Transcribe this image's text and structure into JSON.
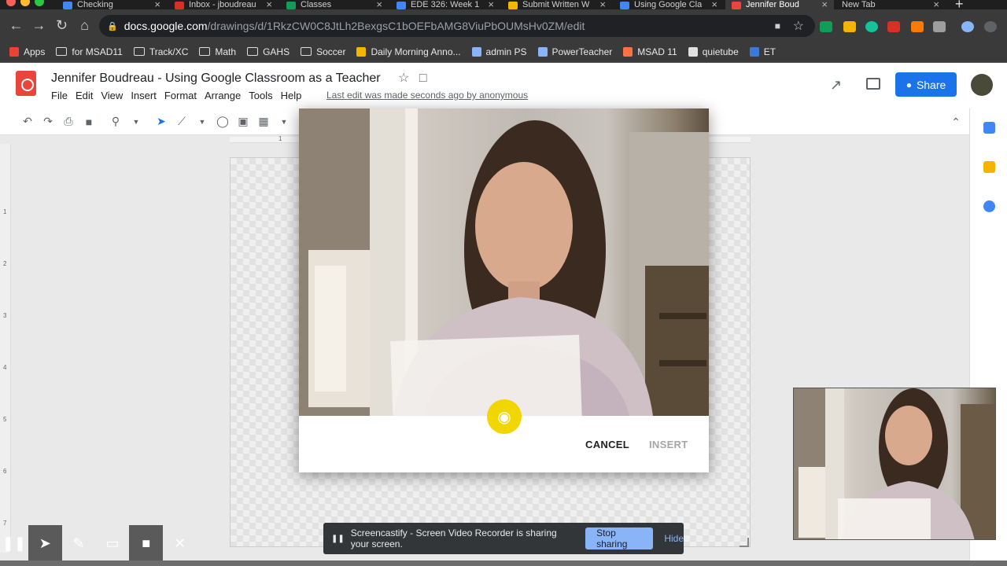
{
  "tabs": [
    {
      "label": "Checking",
      "color": "#4285f4",
      "active": false
    },
    {
      "label": "Inbox - jboudreau",
      "color": "#d93025",
      "active": false
    },
    {
      "label": "Classes",
      "color": "#0f9d58",
      "active": false
    },
    {
      "label": "EDE 326: Week 1",
      "color": "#4285f4",
      "active": false
    },
    {
      "label": "Submit Written W",
      "color": "#f4b400",
      "active": false
    },
    {
      "label": "Using Google Cla",
      "color": "#4285f4",
      "active": false
    },
    {
      "label": "Jennifer Boud",
      "color": "#e8453c",
      "active": true
    },
    {
      "label": "New Tab",
      "color": "",
      "active": false
    }
  ],
  "address": {
    "domain": "docs.google.com",
    "path": "/drawings/d/1RkzCW0C8JtLh2BexgsC1bOEFbAMG8ViuPbOUMsHv0ZM/edit"
  },
  "bookmarks": [
    {
      "label": "Apps",
      "icon": "apps-grid-icon"
    },
    {
      "label": "for MSAD11",
      "icon": "folder-icon"
    },
    {
      "label": "Track/XC",
      "icon": "folder-icon"
    },
    {
      "label": "Math",
      "icon": "folder-icon"
    },
    {
      "label": "GAHS",
      "icon": "folder-icon"
    },
    {
      "label": "Soccer",
      "icon": "folder-icon"
    },
    {
      "label": "Daily Morning Anno...",
      "icon": "note-icon"
    },
    {
      "label": "admin PS",
      "icon": "powerschool-icon"
    },
    {
      "label": "PowerTeacher",
      "icon": "powerschool-icon"
    },
    {
      "label": "MSAD 11",
      "icon": "msad-icon"
    },
    {
      "label": "quietube",
      "icon": "globe-icon"
    },
    {
      "label": "ET",
      "icon": "et-icon"
    }
  ],
  "doc": {
    "title": "Jennifer Boudreau - Using Google Classroom as a Teacher",
    "menus": [
      "File",
      "Edit",
      "View",
      "Insert",
      "Format",
      "Arrange",
      "Tools",
      "Help"
    ],
    "last_edit": "Last edit was made seconds ago by anonymous",
    "share_label": "Share"
  },
  "dialog": {
    "cancel_label": "CANCEL",
    "insert_label": "INSERT"
  },
  "sharing": {
    "message": "Screencastify - Screen Video Recorder is sharing your screen.",
    "stop_label": "Stop sharing",
    "hide_label": "Hide"
  },
  "ruler": {
    "top_mark": "1",
    "left_marks": [
      "1",
      "2",
      "3",
      "4",
      "5",
      "6",
      "7"
    ]
  },
  "colors": {
    "share_blue": "#1a73e8",
    "shutter_yellow": "#f2d600",
    "stop_sharing": "#8ab4f8"
  }
}
